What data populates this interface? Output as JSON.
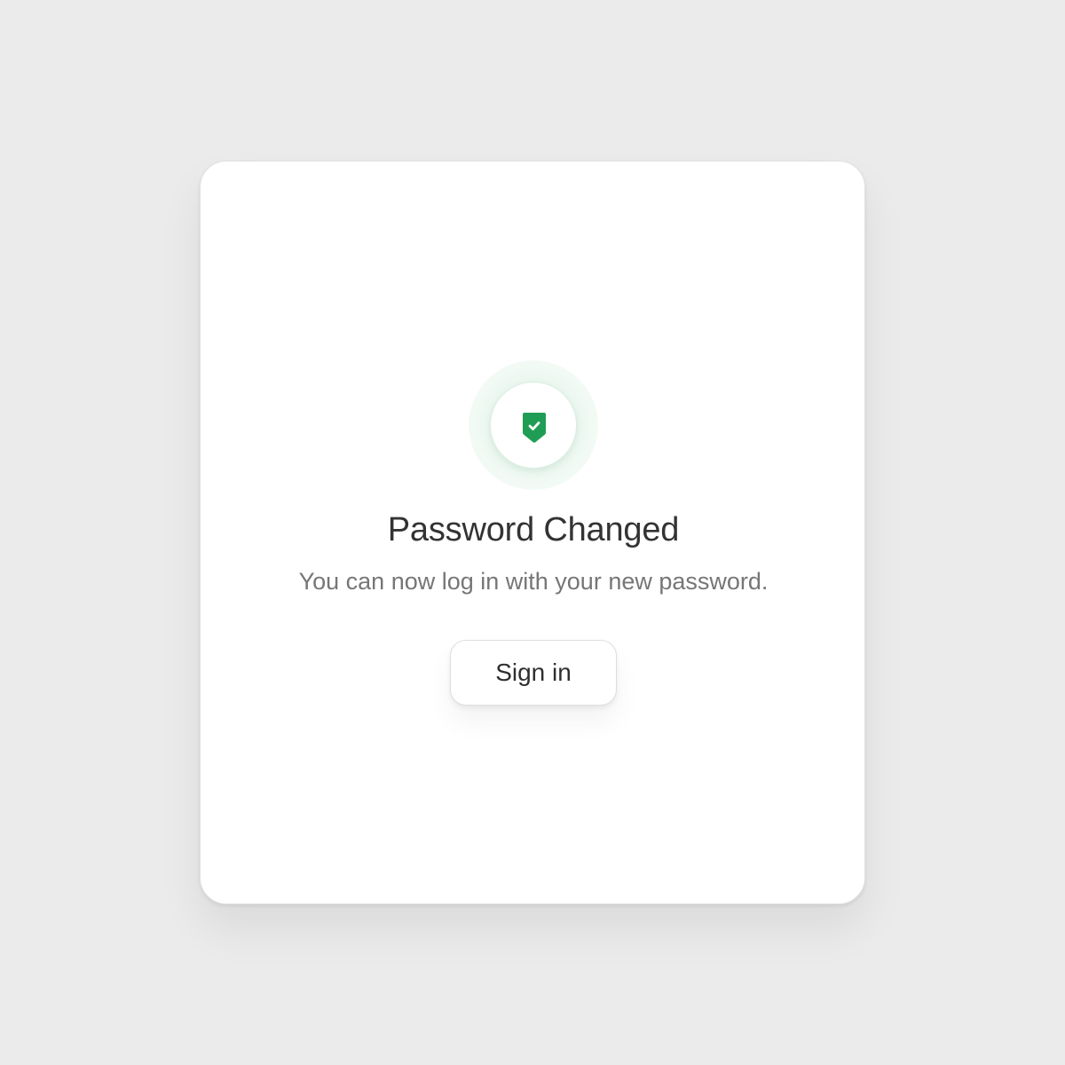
{
  "dialog": {
    "icon": "shield-check-icon",
    "accent_color": "#1f9d55",
    "title": "Password Changed",
    "message": "You can now log in with your new password.",
    "primary_action_label": "Sign in"
  }
}
